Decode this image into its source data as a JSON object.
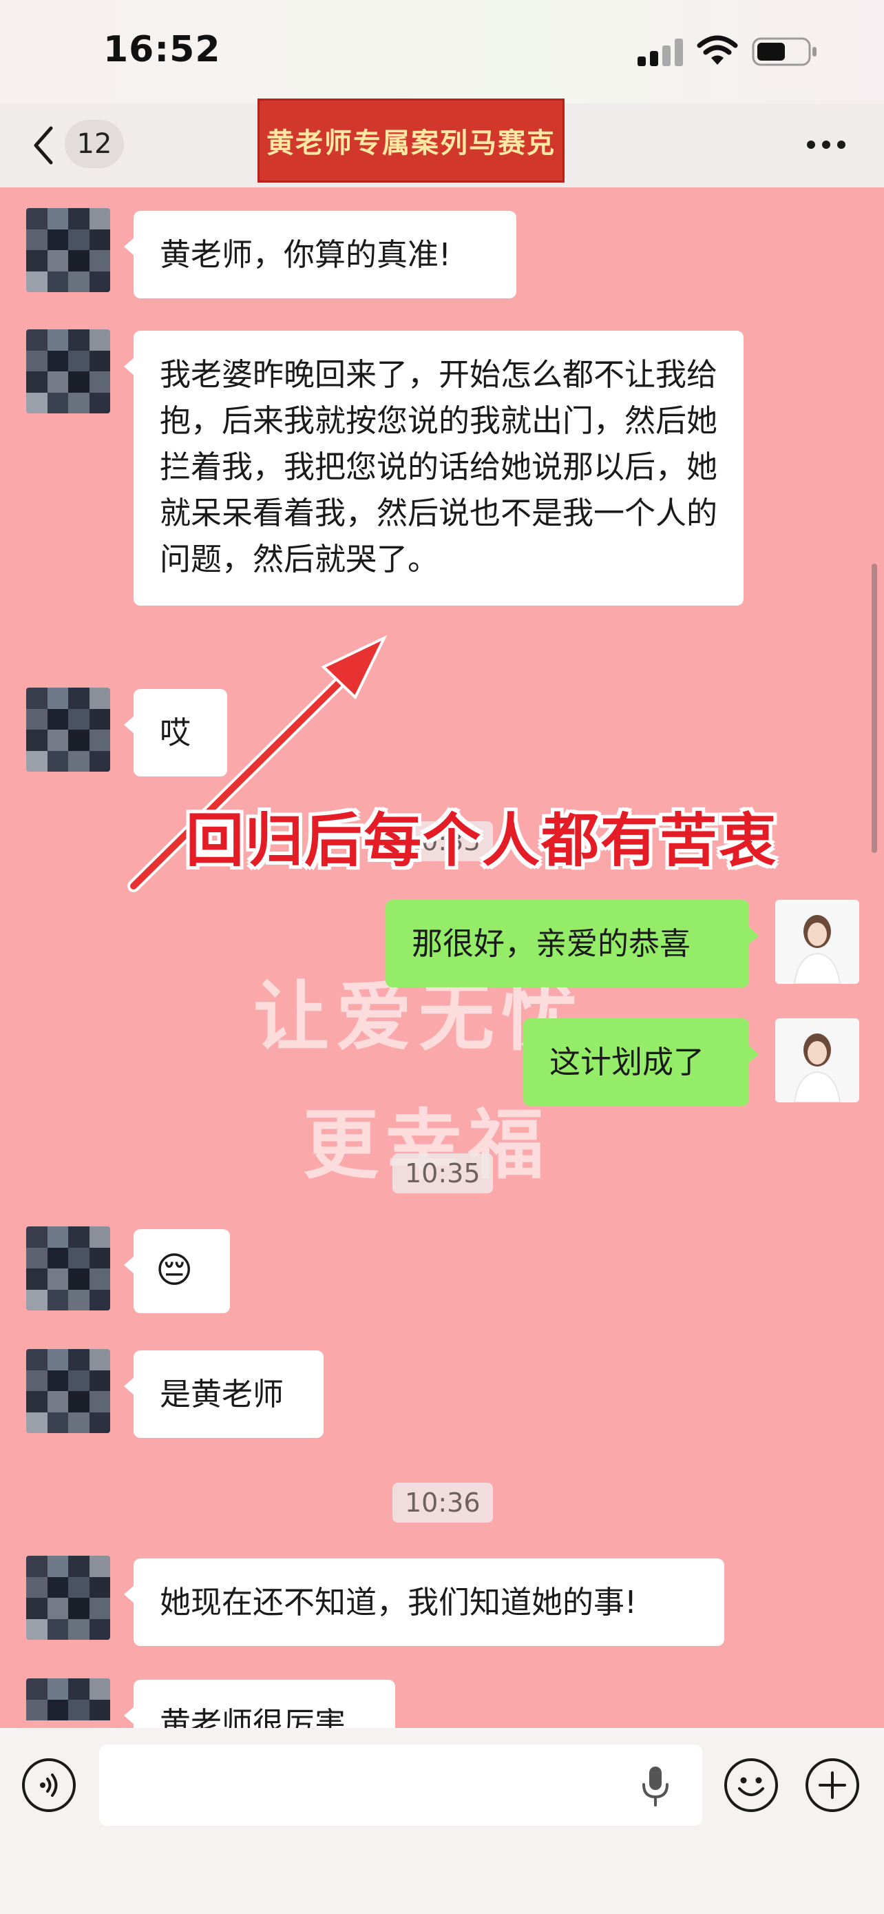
{
  "status_bar": {
    "time": "16:52"
  },
  "nav": {
    "back_count": "12",
    "title": "黄老师专属案列马赛克",
    "more_label": "···"
  },
  "chat": {
    "messages": [
      {
        "side": "left",
        "text": "黄老师，你算的真准!"
      },
      {
        "side": "left",
        "text": "我老婆昨晚回来了，开始怎么都不让我给抱，后来我就按您说的我就出门，然后她拦着我，我把您说的话给她说那以后，她就呆呆看着我，然后说也不是我一个人的问题，然后就哭了。"
      },
      {
        "side": "left",
        "text": "哎"
      },
      {
        "side": "right",
        "text": "那很好，亲爱的恭喜"
      },
      {
        "side": "right",
        "text": "这计划成了"
      },
      {
        "side": "left",
        "text": "😔"
      },
      {
        "side": "left",
        "text": "是黄老师"
      },
      {
        "side": "left",
        "text": "她现在还不知道，我们知道她的事!"
      },
      {
        "side": "left",
        "text": "黄老师很厉害"
      }
    ],
    "timestamps": [
      "10:33",
      "10:35",
      "10:36"
    ],
    "watermark": [
      "让爱无忧",
      "更幸福"
    ],
    "annotation": "回归后每个人都有苦衷"
  },
  "colors": {
    "chat_background": "#fba8ab",
    "left_bubble": "#ffffff",
    "right_bubble": "#95ec69",
    "annotation": "#e31c25",
    "banner": "#d2372c"
  },
  "icons": {
    "back": "chevron-left-icon",
    "more": "more-dots-icon",
    "voice": "voice-toggle-icon",
    "mic": "microphone-icon",
    "emoji": "emoji-icon",
    "plus": "plus-icon"
  }
}
